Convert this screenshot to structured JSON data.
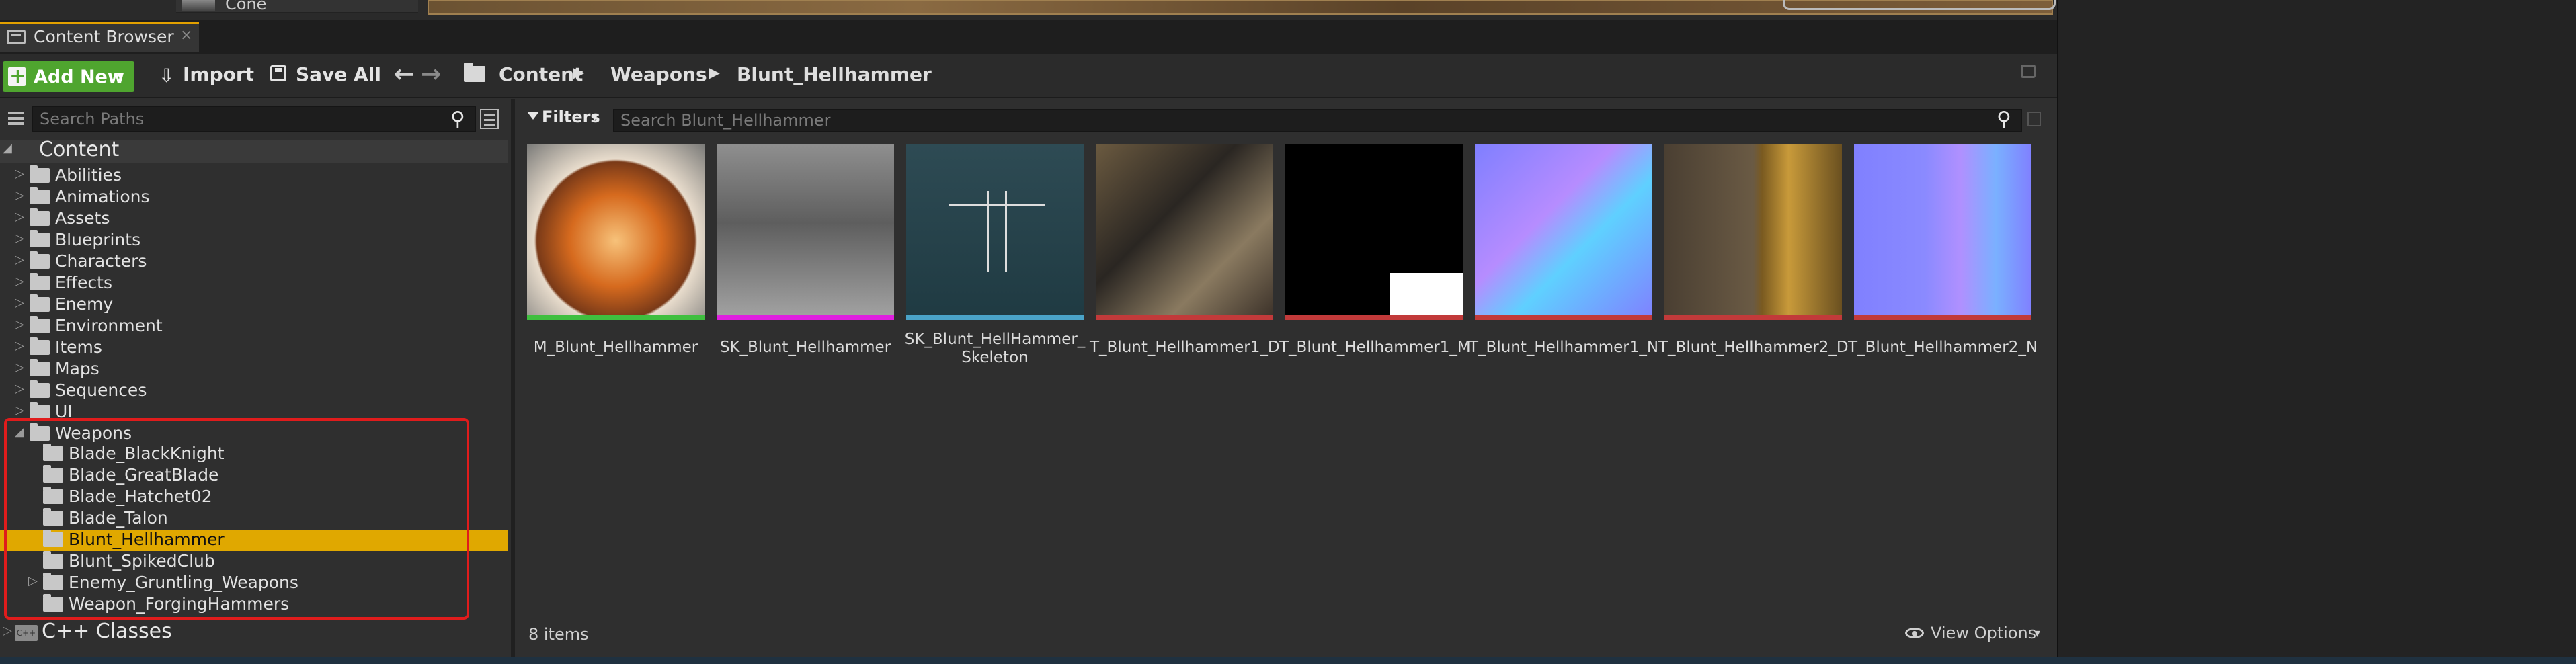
{
  "top": {
    "item_label": "Cone"
  },
  "tab": {
    "label": "Content Browser",
    "close": "×"
  },
  "toolbar": {
    "add_new": "Add New",
    "import": "Import",
    "save_all": "Save All"
  },
  "breadcrumb": [
    "Content",
    "Weapons",
    "Blunt_Hellhammer"
  ],
  "tree": {
    "search_placeholder": "Search Paths",
    "root": "Content",
    "items": [
      "Abilities",
      "Animations",
      "Assets",
      "Blueprints",
      "Characters",
      "Effects",
      "Enemy",
      "Environment",
      "Items",
      "Maps",
      "Sequences",
      "UI",
      "Weapons"
    ],
    "weapon_children": [
      "Blade_BlackKnight",
      "Blade_GreatBlade",
      "Blade_Hatchet02",
      "Blade_Talon",
      "Blunt_Hellhammer",
      "Blunt_SpikedClub",
      "Enemy_Gruntling_Weapons",
      "Weapon_ForgingHammers"
    ],
    "selected": "Blunt_Hellhammer",
    "cpp": "C++ Classes"
  },
  "content": {
    "filters": "Filters",
    "search_placeholder": "Search Blunt_Hellhammer",
    "assets": [
      {
        "name": "M_Blunt_Hellhammer",
        "type_color": "#3fbf3f"
      },
      {
        "name": "SK_Blunt_Hellhammer",
        "type_color": "#e020e0"
      },
      {
        "name": "SK_Blunt_HellHammer_\nSkeleton",
        "type_color": "#4aa3c8"
      },
      {
        "name": "T_Blunt_Hellhammer1_D",
        "type_color": "#c23a3a"
      },
      {
        "name": "T_Blunt_Hellhammer1_M",
        "type_color": "#c23a3a"
      },
      {
        "name": "T_Blunt_Hellhammer1_N",
        "type_color": "#c23a3a"
      },
      {
        "name": "T_Blunt_Hellhammer2_D",
        "type_color": "#c23a3a"
      },
      {
        "name": "T_Blunt_Hellhammer2_N",
        "type_color": "#c23a3a"
      }
    ],
    "items_count": "8 items",
    "view_options": "View Options"
  },
  "colors": {
    "accent": "#e0a800",
    "add_new": "#4fa52f",
    "highlight": "#e01c1c"
  }
}
